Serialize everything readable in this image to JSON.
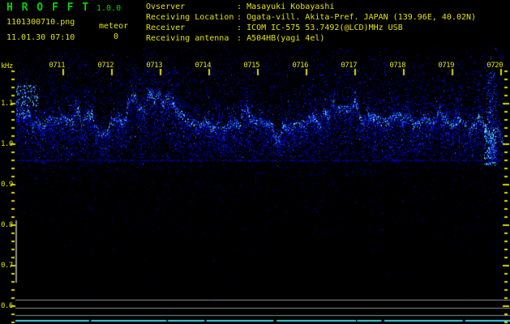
{
  "app": {
    "title": "H R O F F T",
    "version": "1.0.0"
  },
  "session": {
    "filename": "1101300710.png",
    "mode_label": "meteor",
    "meteor_count": "0",
    "datetime": "11.01.30 07:10"
  },
  "info": {
    "separator": ":",
    "rows": [
      {
        "label": "Ovserver",
        "value": "Masayuki Kobayashi"
      },
      {
        "label": "Receiving Location",
        "value": "Ogata-vill. Akita-Pref. JAPAN (139.96E, 40.02N)"
      },
      {
        "label": "Receiver",
        "value": "ICOM IC-575 53.7492(@LCD)MHz USB"
      },
      {
        "label": "Receiving antenna",
        "value": "A504HB(yagi 4el)"
      }
    ]
  },
  "chart_data": {
    "type": "heatmap",
    "subtype": "radio-spectrogram",
    "x_ticks": [
      "0711",
      "0712",
      "0713",
      "0714",
      "0715",
      "0716",
      "0717",
      "0718",
      "0719",
      "0720"
    ],
    "x_axis": "time (HHMM), 1 minute per division",
    "y_unit": "kHz",
    "y_ticks": [
      "1.1",
      "1.0",
      "0.9",
      "0.8",
      "0.7",
      "0.6"
    ],
    "y_range_khz": [
      0.56,
      1.23
    ],
    "grid": false,
    "legend": false,
    "content": {
      "noise_band_khz": [
        1.0,
        1.15
      ],
      "noise_band_description": "continuous blue noise band with ragged bright ridge wandering around 1.05-1.10 kHz across whole 0711-0720 interval",
      "meteor_echo_columns_hhmm": [
        "0713 weak streak",
        "0719.7 strong streak near 0720"
      ],
      "dotted_baseline_khz": 0.96,
      "faint_dotted_rows_khz": [
        1.17,
        1.15,
        1.13
      ],
      "gray_reference_lines_khz": [
        0.616,
        0.596,
        0.578
      ],
      "gray_vertical_scale_bar_khz": [
        0.66,
        0.81
      ],
      "carrier_line_khz": 0.565,
      "meteor_count_shown": 0
    },
    "colors": {
      "background": "#000000",
      "noise_levels": [
        "#000068",
        "#0000b4",
        "#0a28e6",
        "#1d5ef0",
        "#33b4f4",
        "#7deef2"
      ],
      "axis_text": "#e3e300",
      "header_accent": "#00d400",
      "reference_line": "#8c8c8c",
      "carrier_line": "#38d9e8"
    }
  }
}
